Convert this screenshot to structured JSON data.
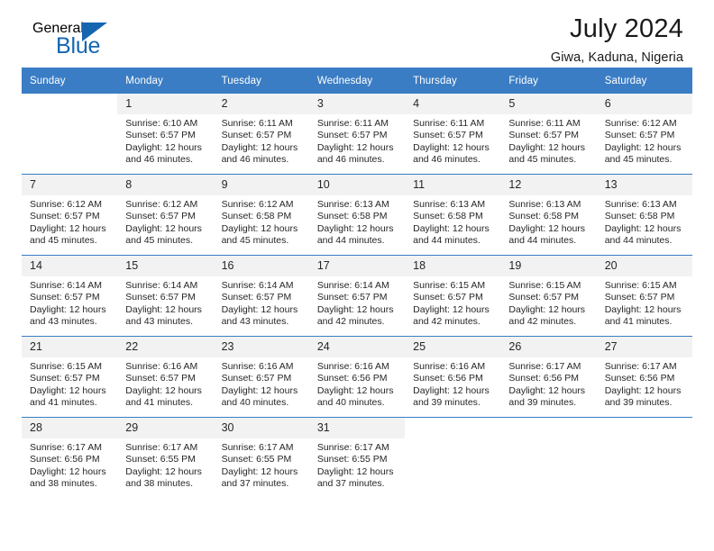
{
  "brand": {
    "name_part1": "General",
    "name_part2": "Blue",
    "flag_icon": "blue-triangle-flag"
  },
  "header": {
    "title": "July 2024",
    "subtitle": "Giwa, Kaduna, Nigeria"
  },
  "colors": {
    "header_blue": "#3b7dc4",
    "brand_blue": "#1565b0",
    "daynum_background": "#f2f2f2"
  },
  "weekday_headers": [
    "Sunday",
    "Monday",
    "Tuesday",
    "Wednesday",
    "Thursday",
    "Friday",
    "Saturday"
  ],
  "weeks": [
    [
      {
        "day": ""
      },
      {
        "day": "1",
        "sunrise": "Sunrise: 6:10 AM",
        "sunset": "Sunset: 6:57 PM",
        "daylight_line1": "Daylight: 12 hours",
        "daylight_line2": "and 46 minutes."
      },
      {
        "day": "2",
        "sunrise": "Sunrise: 6:11 AM",
        "sunset": "Sunset: 6:57 PM",
        "daylight_line1": "Daylight: 12 hours",
        "daylight_line2": "and 46 minutes."
      },
      {
        "day": "3",
        "sunrise": "Sunrise: 6:11 AM",
        "sunset": "Sunset: 6:57 PM",
        "daylight_line1": "Daylight: 12 hours",
        "daylight_line2": "and 46 minutes."
      },
      {
        "day": "4",
        "sunrise": "Sunrise: 6:11 AM",
        "sunset": "Sunset: 6:57 PM",
        "daylight_line1": "Daylight: 12 hours",
        "daylight_line2": "and 46 minutes."
      },
      {
        "day": "5",
        "sunrise": "Sunrise: 6:11 AM",
        "sunset": "Sunset: 6:57 PM",
        "daylight_line1": "Daylight: 12 hours",
        "daylight_line2": "and 45 minutes."
      },
      {
        "day": "6",
        "sunrise": "Sunrise: 6:12 AM",
        "sunset": "Sunset: 6:57 PM",
        "daylight_line1": "Daylight: 12 hours",
        "daylight_line2": "and 45 minutes."
      }
    ],
    [
      {
        "day": "7",
        "sunrise": "Sunrise: 6:12 AM",
        "sunset": "Sunset: 6:57 PM",
        "daylight_line1": "Daylight: 12 hours",
        "daylight_line2": "and 45 minutes."
      },
      {
        "day": "8",
        "sunrise": "Sunrise: 6:12 AM",
        "sunset": "Sunset: 6:57 PM",
        "daylight_line1": "Daylight: 12 hours",
        "daylight_line2": "and 45 minutes."
      },
      {
        "day": "9",
        "sunrise": "Sunrise: 6:12 AM",
        "sunset": "Sunset: 6:58 PM",
        "daylight_line1": "Daylight: 12 hours",
        "daylight_line2": "and 45 minutes."
      },
      {
        "day": "10",
        "sunrise": "Sunrise: 6:13 AM",
        "sunset": "Sunset: 6:58 PM",
        "daylight_line1": "Daylight: 12 hours",
        "daylight_line2": "and 44 minutes."
      },
      {
        "day": "11",
        "sunrise": "Sunrise: 6:13 AM",
        "sunset": "Sunset: 6:58 PM",
        "daylight_line1": "Daylight: 12 hours",
        "daylight_line2": "and 44 minutes."
      },
      {
        "day": "12",
        "sunrise": "Sunrise: 6:13 AM",
        "sunset": "Sunset: 6:58 PM",
        "daylight_line1": "Daylight: 12 hours",
        "daylight_line2": "and 44 minutes."
      },
      {
        "day": "13",
        "sunrise": "Sunrise: 6:13 AM",
        "sunset": "Sunset: 6:58 PM",
        "daylight_line1": "Daylight: 12 hours",
        "daylight_line2": "and 44 minutes."
      }
    ],
    [
      {
        "day": "14",
        "sunrise": "Sunrise: 6:14 AM",
        "sunset": "Sunset: 6:57 PM",
        "daylight_line1": "Daylight: 12 hours",
        "daylight_line2": "and 43 minutes."
      },
      {
        "day": "15",
        "sunrise": "Sunrise: 6:14 AM",
        "sunset": "Sunset: 6:57 PM",
        "daylight_line1": "Daylight: 12 hours",
        "daylight_line2": "and 43 minutes."
      },
      {
        "day": "16",
        "sunrise": "Sunrise: 6:14 AM",
        "sunset": "Sunset: 6:57 PM",
        "daylight_line1": "Daylight: 12 hours",
        "daylight_line2": "and 43 minutes."
      },
      {
        "day": "17",
        "sunrise": "Sunrise: 6:14 AM",
        "sunset": "Sunset: 6:57 PM",
        "daylight_line1": "Daylight: 12 hours",
        "daylight_line2": "and 42 minutes."
      },
      {
        "day": "18",
        "sunrise": "Sunrise: 6:15 AM",
        "sunset": "Sunset: 6:57 PM",
        "daylight_line1": "Daylight: 12 hours",
        "daylight_line2": "and 42 minutes."
      },
      {
        "day": "19",
        "sunrise": "Sunrise: 6:15 AM",
        "sunset": "Sunset: 6:57 PM",
        "daylight_line1": "Daylight: 12 hours",
        "daylight_line2": "and 42 minutes."
      },
      {
        "day": "20",
        "sunrise": "Sunrise: 6:15 AM",
        "sunset": "Sunset: 6:57 PM",
        "daylight_line1": "Daylight: 12 hours",
        "daylight_line2": "and 41 minutes."
      }
    ],
    [
      {
        "day": "21",
        "sunrise": "Sunrise: 6:15 AM",
        "sunset": "Sunset: 6:57 PM",
        "daylight_line1": "Daylight: 12 hours",
        "daylight_line2": "and 41 minutes."
      },
      {
        "day": "22",
        "sunrise": "Sunrise: 6:16 AM",
        "sunset": "Sunset: 6:57 PM",
        "daylight_line1": "Daylight: 12 hours",
        "daylight_line2": "and 41 minutes."
      },
      {
        "day": "23",
        "sunrise": "Sunrise: 6:16 AM",
        "sunset": "Sunset: 6:57 PM",
        "daylight_line1": "Daylight: 12 hours",
        "daylight_line2": "and 40 minutes."
      },
      {
        "day": "24",
        "sunrise": "Sunrise: 6:16 AM",
        "sunset": "Sunset: 6:56 PM",
        "daylight_line1": "Daylight: 12 hours",
        "daylight_line2": "and 40 minutes."
      },
      {
        "day": "25",
        "sunrise": "Sunrise: 6:16 AM",
        "sunset": "Sunset: 6:56 PM",
        "daylight_line1": "Daylight: 12 hours",
        "daylight_line2": "and 39 minutes."
      },
      {
        "day": "26",
        "sunrise": "Sunrise: 6:17 AM",
        "sunset": "Sunset: 6:56 PM",
        "daylight_line1": "Daylight: 12 hours",
        "daylight_line2": "and 39 minutes."
      },
      {
        "day": "27",
        "sunrise": "Sunrise: 6:17 AM",
        "sunset": "Sunset: 6:56 PM",
        "daylight_line1": "Daylight: 12 hours",
        "daylight_line2": "and 39 minutes."
      }
    ],
    [
      {
        "day": "28",
        "sunrise": "Sunrise: 6:17 AM",
        "sunset": "Sunset: 6:56 PM",
        "daylight_line1": "Daylight: 12 hours",
        "daylight_line2": "and 38 minutes."
      },
      {
        "day": "29",
        "sunrise": "Sunrise: 6:17 AM",
        "sunset": "Sunset: 6:55 PM",
        "daylight_line1": "Daylight: 12 hours",
        "daylight_line2": "and 38 minutes."
      },
      {
        "day": "30",
        "sunrise": "Sunrise: 6:17 AM",
        "sunset": "Sunset: 6:55 PM",
        "daylight_line1": "Daylight: 12 hours",
        "daylight_line2": "and 37 minutes."
      },
      {
        "day": "31",
        "sunrise": "Sunrise: 6:17 AM",
        "sunset": "Sunset: 6:55 PM",
        "daylight_line1": "Daylight: 12 hours",
        "daylight_line2": "and 37 minutes."
      },
      {
        "day": ""
      },
      {
        "day": ""
      },
      {
        "day": ""
      }
    ]
  ]
}
